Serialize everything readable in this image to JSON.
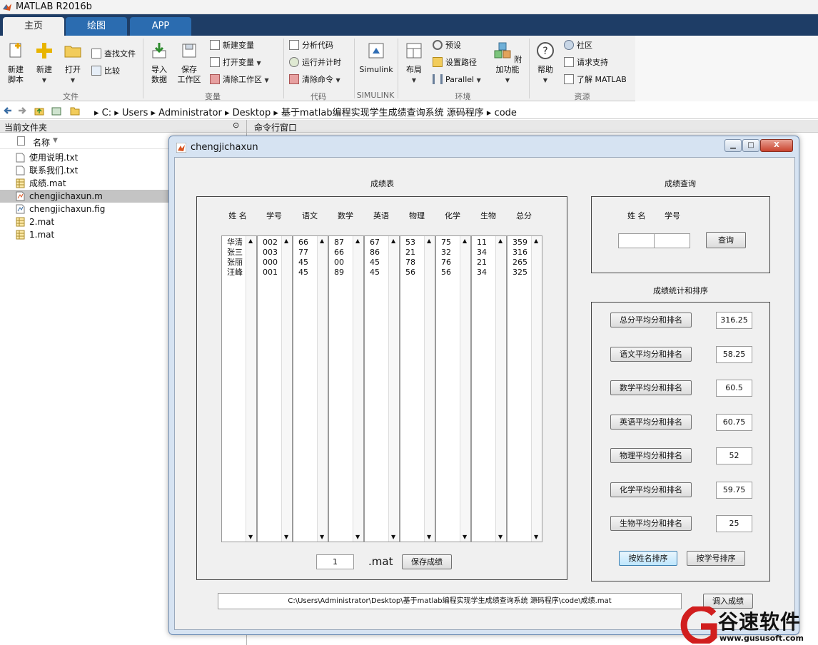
{
  "window": {
    "title": "MATLAB R2016b"
  },
  "tabs": [
    "主页",
    "绘图",
    "APP"
  ],
  "ribbon": {
    "file": {
      "group": "文件",
      "new_script": "新建\n脚本",
      "new": "新建",
      "open": "打开",
      "find_files": "查找文件",
      "compare": "比较"
    },
    "variable": {
      "group": "变量",
      "import": "导入\n数据",
      "save_ws": "保存\n工作区",
      "new_var": "新建变量",
      "open_var": "打开变量",
      "clear_ws": "清除工作区"
    },
    "code": {
      "group": "代码",
      "analyze": "分析代码",
      "run_time": "运行并计时",
      "clear_cmd": "清除命令"
    },
    "simulink": {
      "group": "SIMULINK",
      "simulink": "Simulink"
    },
    "env": {
      "group": "环境",
      "layout": "布局",
      "preferences": "预设",
      "set_path": "设置路径",
      "parallel": "Parallel",
      "addons": "附加功能"
    },
    "resources": {
      "group": "资源",
      "help": "帮助",
      "community": "社区",
      "support": "请求支持",
      "learn": "了解 MATLAB"
    }
  },
  "address": {
    "path": [
      "C:",
      "Users",
      "Administrator",
      "Desktop",
      "基于matlab编程实现学生成绩查询系统 源码程序",
      "code"
    ]
  },
  "left_panel": {
    "title": "当前文件夹",
    "col_name": "名称",
    "files": [
      {
        "name": "使用说明.txt",
        "type": "txt"
      },
      {
        "name": "联系我们.txt",
        "type": "txt"
      },
      {
        "name": "成绩.mat",
        "type": "mat"
      },
      {
        "name": "chengjichaxun.m",
        "type": "m",
        "selected": true
      },
      {
        "name": "chengjichaxun.fig",
        "type": "fig"
      },
      {
        "name": "2.mat",
        "type": "mat"
      },
      {
        "name": "1.mat",
        "type": "mat"
      }
    ]
  },
  "command_window": {
    "title": "命令行窗口"
  },
  "figure": {
    "title": "chengjichaxun",
    "min": "▁",
    "max": "□",
    "close": "X",
    "score_table": {
      "title": "成绩表",
      "headers": [
        "姓 名",
        "学号",
        "语文",
        "数学",
        "英语",
        "物理",
        "化学",
        "生物",
        "总分"
      ],
      "columns": [
        "华清\n张三\n张丽\n汪峰",
        "002\n003\n000\n001",
        "66\n77\n45\n45",
        "87\n66\n00\n89",
        "67\n86\n45\n45",
        "53\n21\n78\n56",
        "75\n32\n76\n56",
        "11\n34\n21\n34",
        "359\n316\n265\n325"
      ],
      "file_index": "1",
      "ext": ".mat",
      "save_btn": "保存成绩"
    },
    "query": {
      "title": "成绩查询",
      "name_label": "姓 名",
      "id_label": "学号",
      "name_value": "",
      "id_value": "",
      "btn": "查询"
    },
    "stats": {
      "title": "成绩统计和排序",
      "rows": [
        {
          "label": "总分平均分和排名",
          "value": "316.25"
        },
        {
          "label": "语文平均分和排名",
          "value": "58.25"
        },
        {
          "label": "数学平均分和排名",
          "value": "60.5"
        },
        {
          "label": "英语平均分和排名",
          "value": "60.75"
        },
        {
          "label": "物理平均分和排名",
          "value": "52"
        },
        {
          "label": "化学平均分和排名",
          "value": "59.75"
        },
        {
          "label": "生物平均分和排名",
          "value": "25"
        }
      ],
      "sort_name": "按姓名排序",
      "sort_id": "按学号排序"
    },
    "load": {
      "path": "C:\\Users\\Administrator\\Desktop\\基于matlab编程实现学生成绩查询系统 源码程序\\code\\成绩.mat",
      "btn": "调入成绩"
    }
  },
  "watermark": {
    "brand": "谷速软件",
    "url": "www.gususoft.com"
  }
}
